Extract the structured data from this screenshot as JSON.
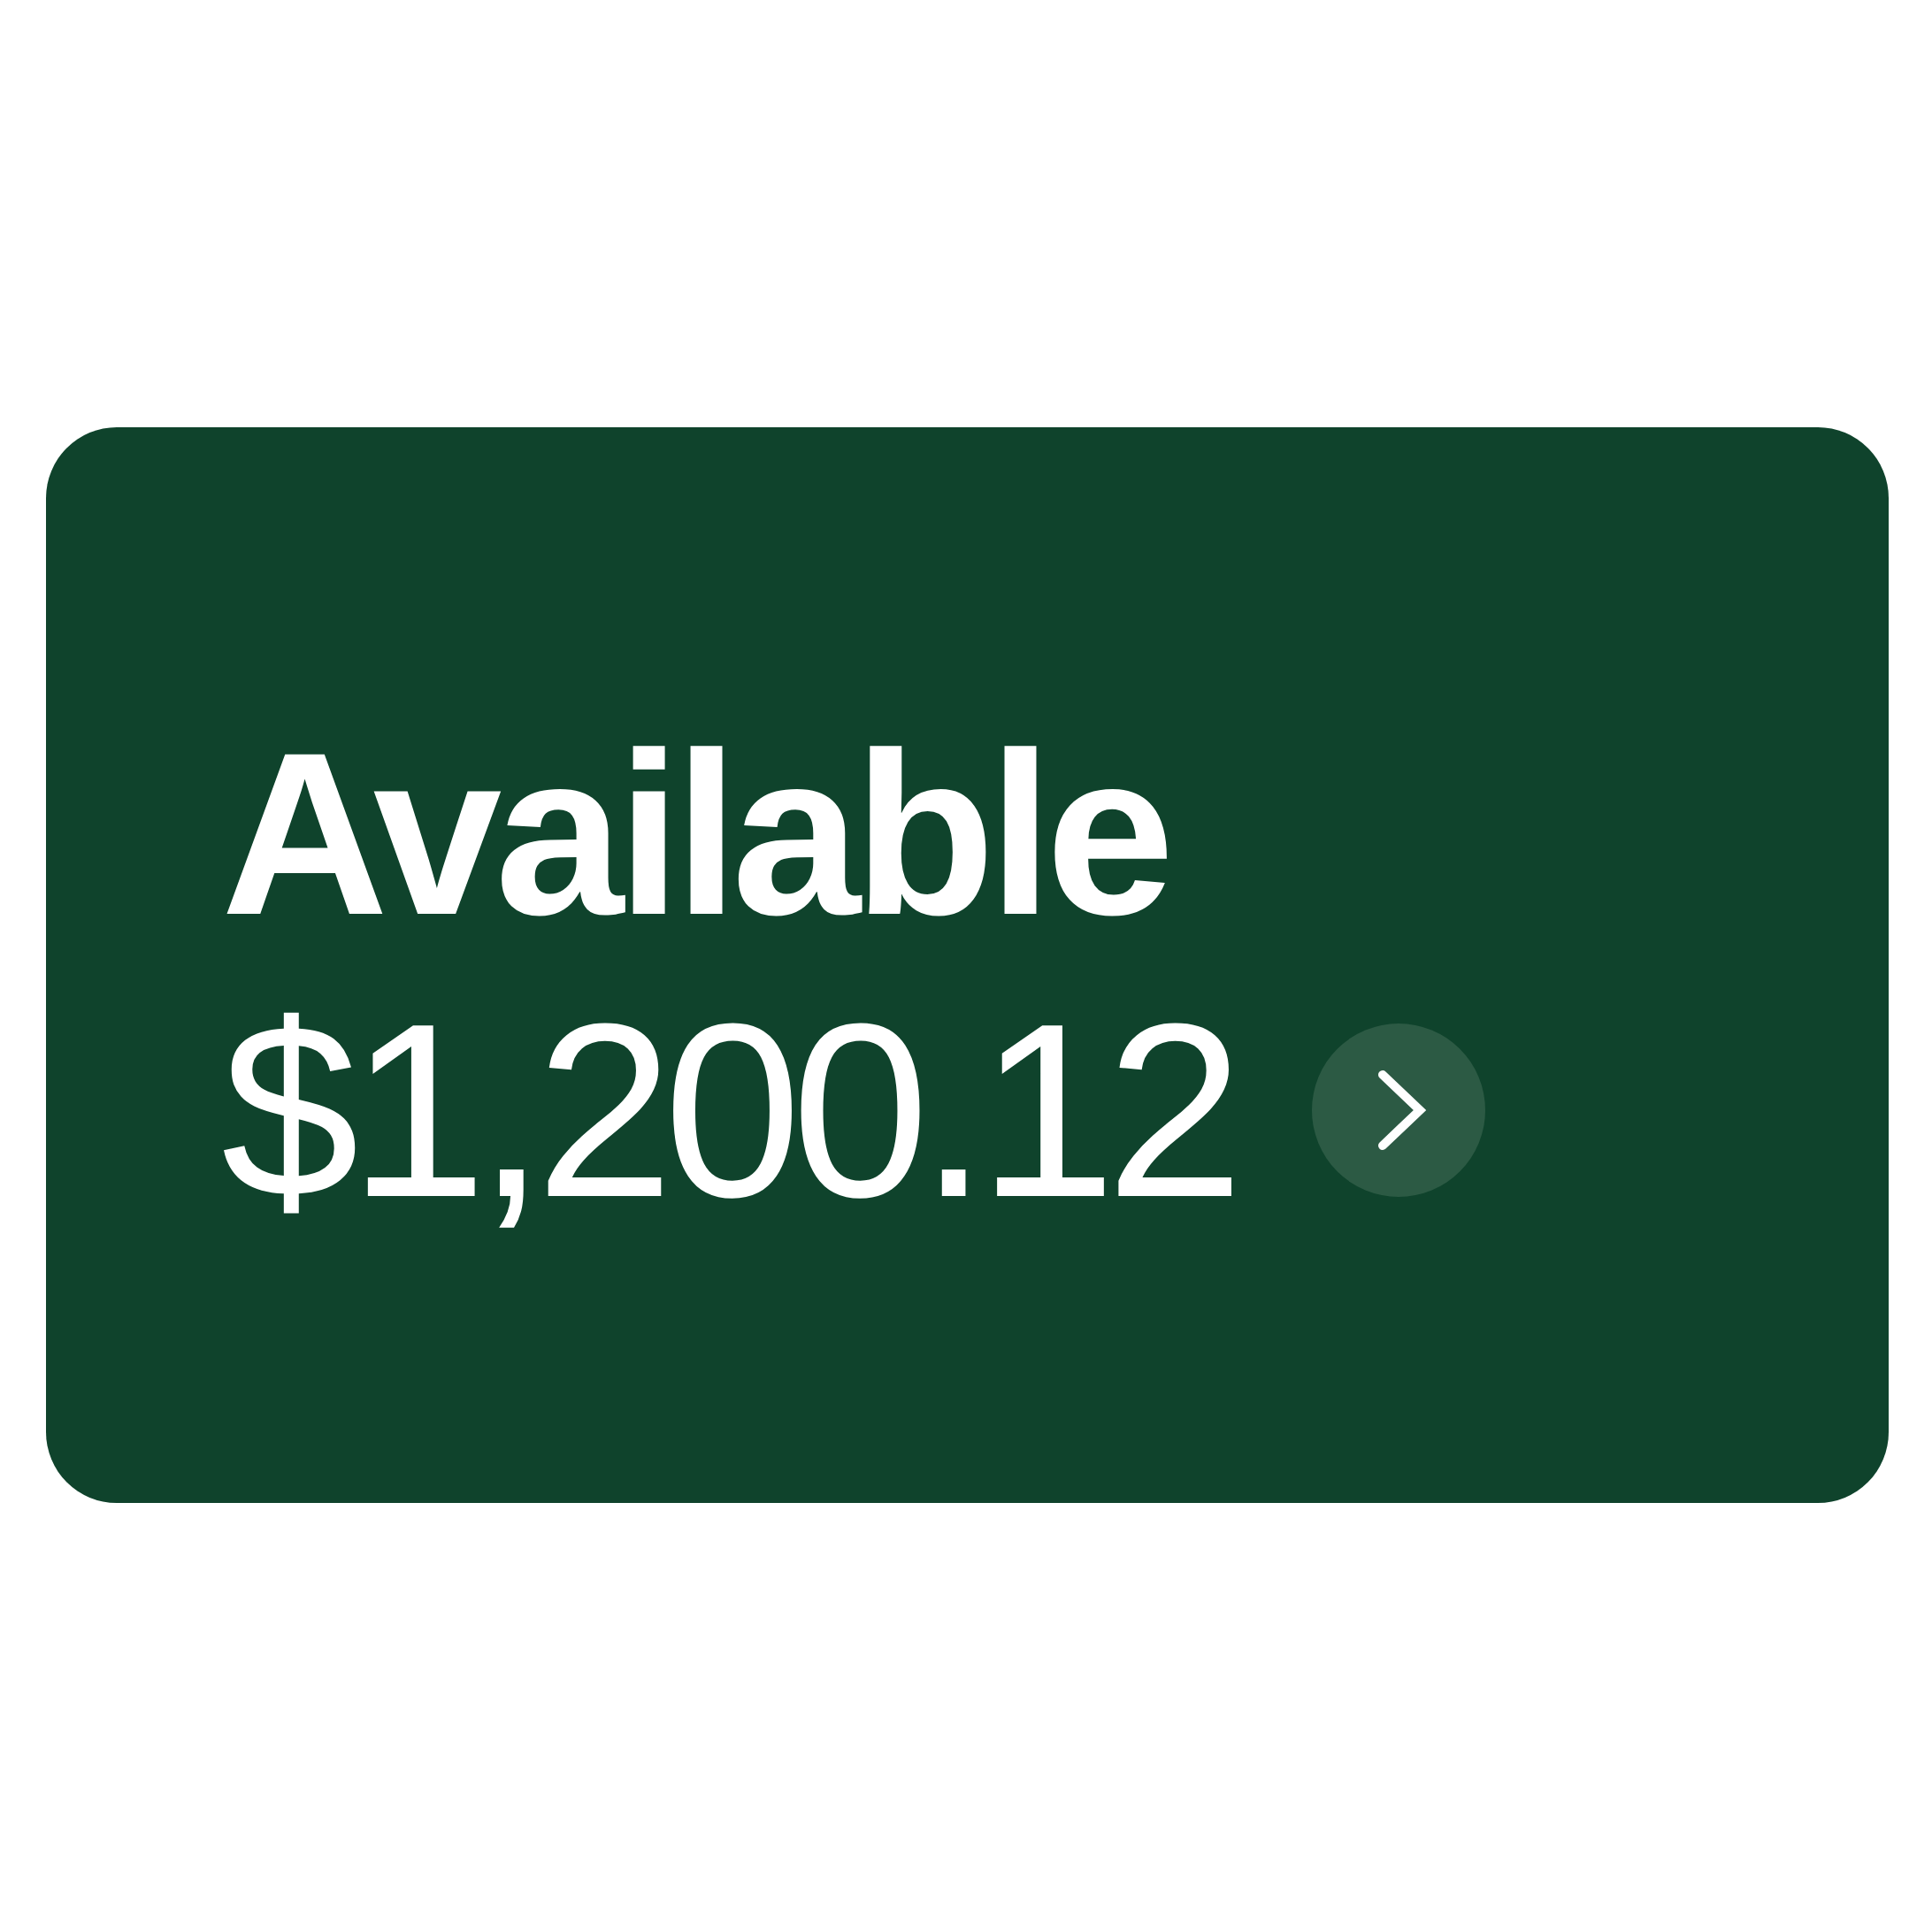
{
  "card": {
    "title": "Available",
    "amount": "$1,200.12",
    "action": {
      "kind": "chevron"
    }
  }
}
